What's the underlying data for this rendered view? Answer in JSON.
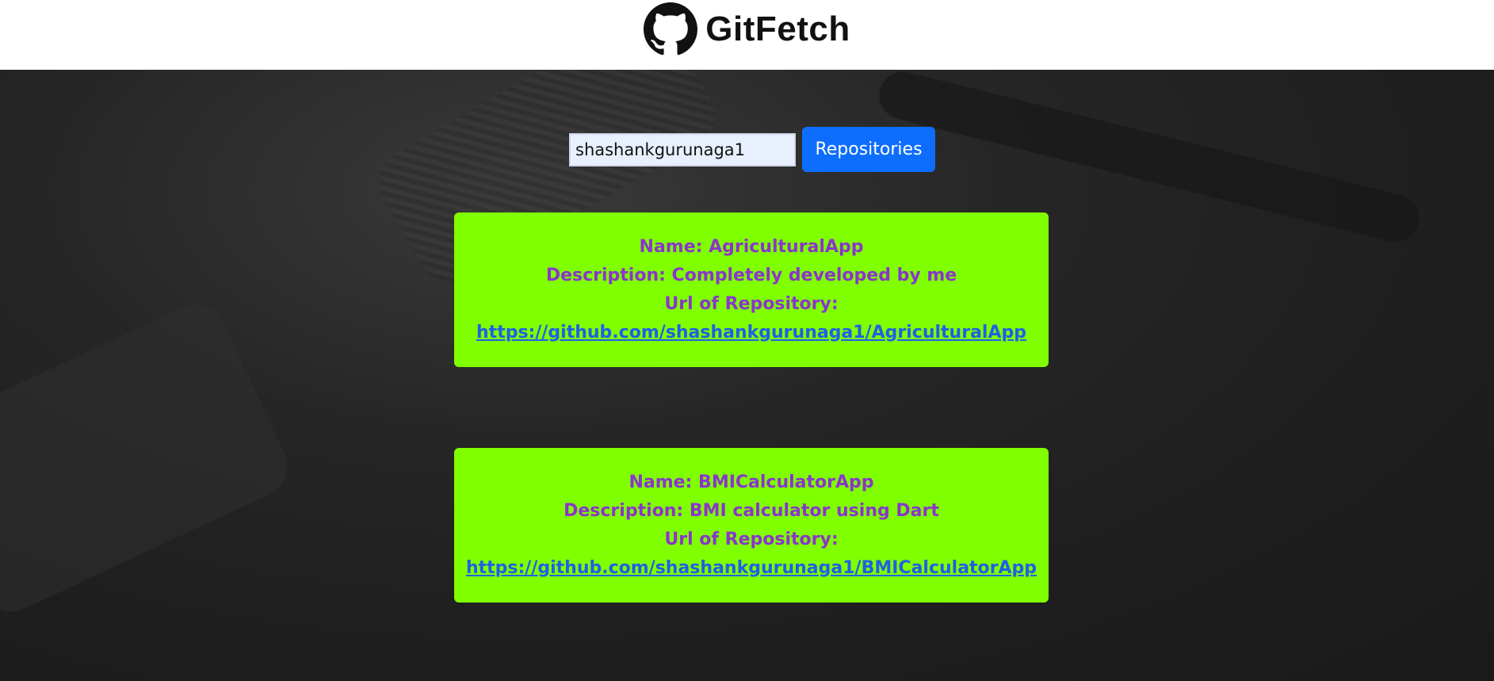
{
  "header": {
    "logo_icon": "github-octocat-icon",
    "title": "GitFetch"
  },
  "search": {
    "value": "shashankgurunaga1",
    "button_label": "Repositories"
  },
  "repositories": [
    {
      "name_line": "Name: AgriculturalApp",
      "description_line": "Description: Completely developed by me",
      "url_label": "Url of Repository:",
      "url": "https://github.com/shashankgurunaga1/AgriculturalApp"
    },
    {
      "name_line": "Name: BMICalculatorApp",
      "description_line": "Description: BMI calculator using Dart",
      "url_label": "Url of Repository:",
      "url": "https://github.com/shashankgurunaga1/BMICalculatorApp"
    }
  ],
  "colors": {
    "header_bg": "#ffffff",
    "card_bg": "#80ff00",
    "card_text": "#8a35cc",
    "link": "#1e60e6",
    "button_bg": "#0d6efd"
  }
}
